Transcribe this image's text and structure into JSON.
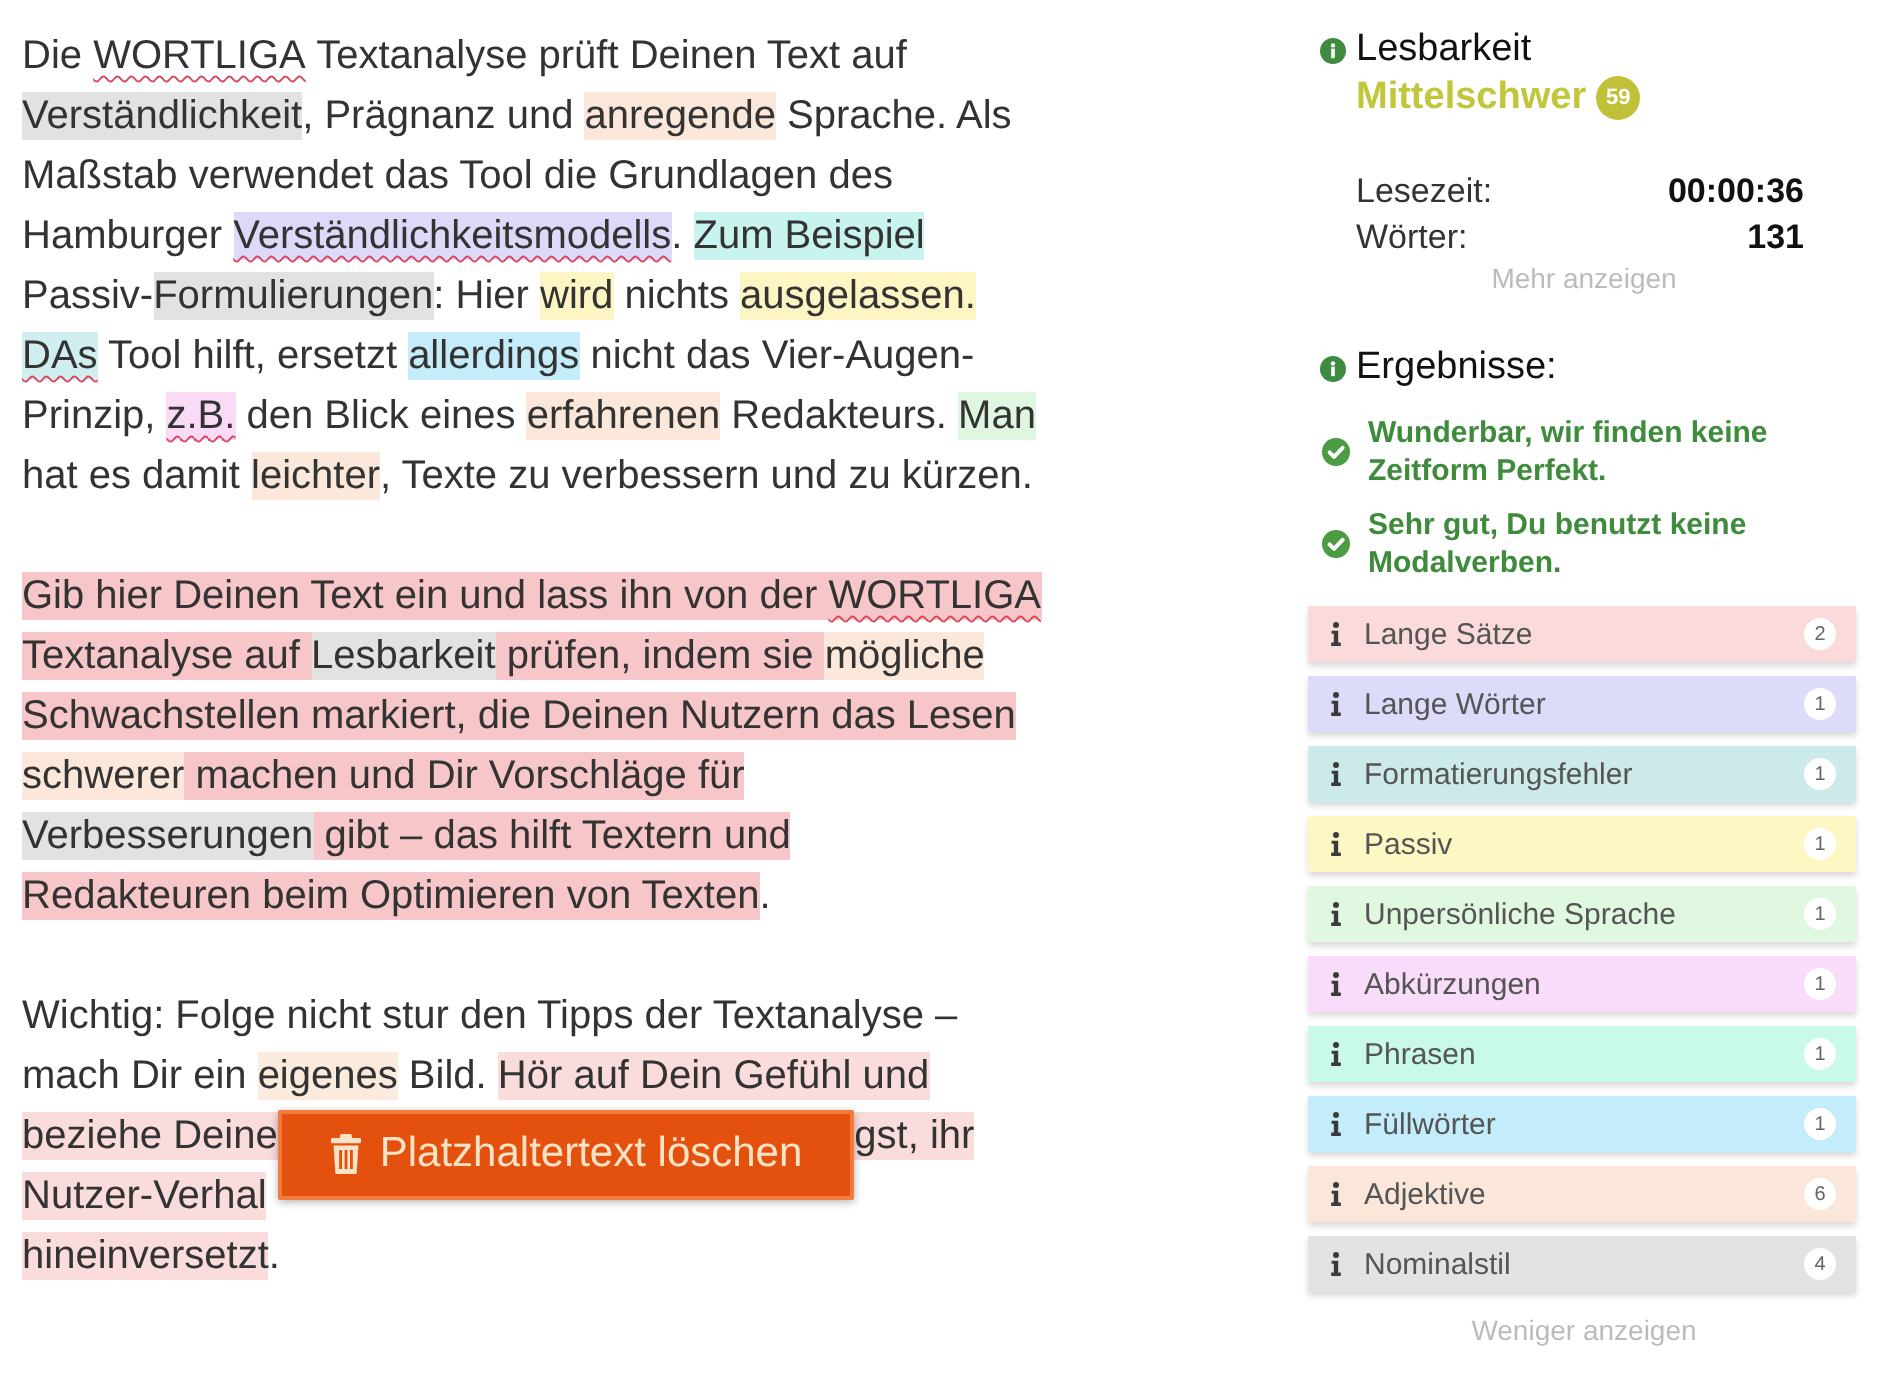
{
  "editor": {
    "paragraphs": [
      {
        "lines": [
          {
            "segments": [
              {
                "kind": "text",
                "text": "Die ",
                "underlined": false
              },
              {
                "kind": "text",
                "text": "WORTLIGA",
                "underlined": true
              },
              {
                "kind": "text",
                "text": " Textanalyse prüft Deinen Text auf",
                "underlined": false
              }
            ]
          },
          {
            "segments": [
              {
                "kind": "text",
                "text": "Verständlichkeit",
                "underlined": false,
                "color": "#e2e2e2"
              },
              {
                "kind": "text",
                "text": ", Prägnanz und ",
                "underlined": false
              },
              {
                "kind": "text",
                "text": "anregende",
                "underlined": false,
                "color": "#fbe8da"
              },
              {
                "kind": "text",
                "text": " Sprache. Als",
                "underlined": false
              }
            ]
          },
          {
            "segments": [
              {
                "kind": "text",
                "text": "Maßstab verwendet das Tool die Grundlagen des",
                "underlined": false
              }
            ]
          },
          {
            "segments": [
              {
                "kind": "text",
                "text": "Hamburger ",
                "underlined": false
              },
              {
                "kind": "text",
                "text": "Verständlichkeitsmodells",
                "underlined": true,
                "color": "#dcdaf8"
              },
              {
                "kind": "text",
                "text": ". ",
                "underlined": false
              },
              {
                "kind": "text",
                "text": "Zum Beispiel",
                "underlined": false,
                "color": "#c8f3ee"
              }
            ]
          },
          {
            "segments": [
              {
                "kind": "text",
                "text": "Passiv-",
                "underlined": false
              },
              {
                "kind": "text",
                "text": "Formulierungen",
                "underlined": false,
                "color": "#e2e2e2"
              },
              {
                "kind": "text",
                "text": ": Hier ",
                "underlined": false
              },
              {
                "kind": "text",
                "text": "wird",
                "underlined": false,
                "color": "#fdf5c4"
              },
              {
                "kind": "text",
                "text": " nichts ",
                "underlined": false
              },
              {
                "kind": "text",
                "text": "ausgelassen.",
                "underlined": false,
                "color": "#fdf5c4"
              }
            ]
          },
          {
            "segments": [
              {
                "kind": "text",
                "text": "DAs",
                "underlined": true,
                "color": "#d0eef0"
              },
              {
                "kind": "text",
                "text": " Tool hilft, ersetzt ",
                "underlined": false
              },
              {
                "kind": "text",
                "text": "allerdings",
                "underlined": false,
                "color": "#c4ecfa"
              },
              {
                "kind": "text",
                "text": " nicht das Vier-Augen-",
                "underlined": false
              }
            ]
          },
          {
            "segments": [
              {
                "kind": "text",
                "text": "Prinzip, ",
                "underlined": false
              },
              {
                "kind": "text",
                "text": "z.B.",
                "underlined": true,
                "color": "#f9dbf6"
              },
              {
                "kind": "text",
                "text": " den Blick eines ",
                "underlined": false
              },
              {
                "kind": "text",
                "text": "erfahrenen",
                "underlined": false,
                "color": "#fbe8da"
              },
              {
                "kind": "text",
                "text": " Redakteurs. ",
                "underlined": false
              },
              {
                "kind": "text",
                "text": "Man",
                "underlined": false,
                "color": "#dff6e0"
              }
            ]
          },
          {
            "segments": [
              {
                "kind": "text",
                "text": "hat es damit ",
                "underlined": false
              },
              {
                "kind": "text",
                "text": "leichter",
                "underlined": false,
                "color": "#fbe8da"
              },
              {
                "kind": "text",
                "text": ", Texte zu verbessern und zu kürzen.",
                "underlined": false
              }
            ]
          }
        ]
      },
      {
        "lines": [
          {
            "segments": [
              {
                "kind": "text",
                "text": "Gib hier Deinen Text ein und lass ihn von der ",
                "underlined": false,
                "color": "#f6c6c9"
              },
              {
                "kind": "text",
                "text": "WORTLIGA",
                "underlined": true,
                "color": "#f6c6c9"
              }
            ]
          },
          {
            "segments": [
              {
                "kind": "text",
                "text": "Textanalyse auf ",
                "underlined": false,
                "color": "#f6c6c9"
              },
              {
                "kind": "text",
                "text": "Lesbarkeit",
                "underlined": false,
                "color": "#e2e2e2"
              },
              {
                "kind": "text",
                "text": " prüfen, indem sie ",
                "underlined": false,
                "color": "#f6c6c9"
              },
              {
                "kind": "text",
                "text": "mögliche",
                "underlined": false,
                "color": "#fbe8da"
              }
            ]
          },
          {
            "segments": [
              {
                "kind": "text",
                "text": "Schwachstellen markiert, die Deinen Nutzern das Lesen",
                "underlined": false,
                "color": "#f6c6c9"
              }
            ]
          },
          {
            "segments": [
              {
                "kind": "text",
                "text": "schwerer",
                "underlined": false,
                "color": "#fbe8da"
              },
              {
                "kind": "text",
                "text": " machen und Dir Vorschläge für",
                "underlined": false,
                "color": "#f6c6c9"
              }
            ]
          },
          {
            "segments": [
              {
                "kind": "text",
                "text": "Verbesserungen",
                "underlined": false,
                "color": "#e2e2e2"
              },
              {
                "kind": "text",
                "text": " gibt – das hilft Textern und",
                "underlined": false,
                "color": "#f6c6c9"
              }
            ]
          },
          {
            "segments": [
              {
                "kind": "text",
                "text": "Redakteuren beim Optimieren von Texten",
                "underlined": false,
                "color": "#f6c6c9"
              },
              {
                "kind": "text",
                "text": ".",
                "underlined": false
              }
            ]
          }
        ]
      },
      {
        "lines": [
          {
            "segments": [
              {
                "kind": "text",
                "text": "Wichtig: Folge nicht stur den Tipps der Textanalyse –",
                "underlined": false
              }
            ]
          },
          {
            "segments": [
              {
                "kind": "text",
                "text": "mach Dir ein ",
                "underlined": false
              },
              {
                "kind": "text",
                "text": "eigenes",
                "underlined": false,
                "color": "#fbebdd"
              },
              {
                "kind": "text",
                "text": " Bild. ",
                "underlined": false
              },
              {
                "kind": "text",
                "text": "Hör auf Dein Gefühl und",
                "underlined": false,
                "color": "#fbdcdc"
              }
            ]
          },
          {
            "segments": [
              {
                "kind": "text",
                "text": "beziehe Deine",
                "underlined": false,
                "color": "#fbdcdc"
              },
              {
                "kind": "button",
                "label": "Platzhaltertext löschen"
              },
              {
                "kind": "text",
                "text": "gst, ihr",
                "underlined": false,
                "color": "#fbdcdc"
              }
            ]
          },
          {
            "segments": [
              {
                "kind": "text",
                "text": "Nutzer-Verhal",
                "underlined": false,
                "color": "#fbdcdc"
              }
            ]
          },
          {
            "segments": [
              {
                "kind": "text",
                "text": "hineinversetzt",
                "underlined": false,
                "color": "#fbdcdc"
              },
              {
                "kind": "text",
                "text": ".",
                "underlined": false
              }
            ]
          }
        ]
      }
    ]
  },
  "readability": {
    "title": "Lesbarkeit",
    "rating": "Mittelschwer",
    "score": "59",
    "stats": [
      {
        "label": "Lesezeit:",
        "value": "00:00:36"
      },
      {
        "label": "Wörter:",
        "value": "131"
      }
    ],
    "more_link": "Mehr anzeigen"
  },
  "results": {
    "title": "Ergebnisse:",
    "messages": [
      "Wunderbar, wir finden keine Zeitform Perfekt.",
      "Sehr gut, Du benutzt keine Modalverben."
    ],
    "categories": [
      {
        "label": "Lange Sätze",
        "count": "2",
        "color": "#fadadb"
      },
      {
        "label": "Lange Wörter",
        "count": "1",
        "color": "#dcdcfa"
      },
      {
        "label": "Formatierungsfehler",
        "count": "1",
        "color": "#cdeaea"
      },
      {
        "label": "Passiv",
        "count": "1",
        "color": "#fdf7c3"
      },
      {
        "label": "Unpersönliche Sprache",
        "count": "1",
        "color": "#e0f8e0"
      },
      {
        "label": "Abkürzungen",
        "count": "1",
        "color": "#f9dcf9"
      },
      {
        "label": "Phrasen",
        "count": "1",
        "color": "#c9f9e9"
      },
      {
        "label": "Füllwörter",
        "count": "1",
        "color": "#c4edfb"
      },
      {
        "label": "Adjektive",
        "count": "6",
        "color": "#fae7da"
      },
      {
        "label": "Nominalstil",
        "count": "4",
        "color": "#e3e3e3"
      }
    ],
    "less_link": "Weniger anzeigen"
  }
}
